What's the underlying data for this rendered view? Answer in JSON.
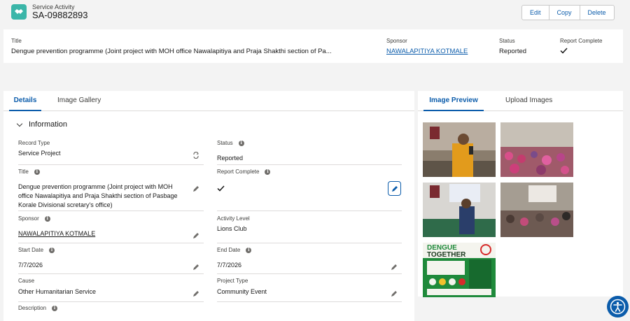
{
  "header": {
    "object_label": "Service Activity",
    "record_name": "SA-09882893",
    "buttons": {
      "edit": "Edit",
      "copy": "Copy",
      "delete": "Delete"
    },
    "icon": "handshake-icon"
  },
  "highlights": {
    "title_label": "Title",
    "title_value": "Dengue prevention programme (Joint project with MOH office Nawalapitiya and Praja Shakthi section of Pa...",
    "sponsor_label": "Sponsor",
    "sponsor_value": "NAWALAPITIYA KOTMALE",
    "status_label": "Status",
    "status_value": "Reported",
    "report_complete_label": "Report Complete"
  },
  "details_tabs": [
    "Details",
    "Image Gallery"
  ],
  "section": {
    "title": "Information"
  },
  "fields": {
    "record_type": {
      "label": "Record Type",
      "value": "Service Project"
    },
    "status": {
      "label": "Status",
      "value": "Reported"
    },
    "title": {
      "label": "Title",
      "value": "Dengue prevention programme (Joint project with MOH office Nawalapitiya and Praja Shakthi section of Pasbage Korale Divisional scretary's office)"
    },
    "report_complete": {
      "label": "Report Complete"
    },
    "sponsor": {
      "label": "Sponsor",
      "value": "NAWALAPITIYA KOTMALE"
    },
    "activity_level": {
      "label": "Activity Level",
      "value": "Lions Club"
    },
    "start_date": {
      "label": "Start Date",
      "value": "7/7/2026"
    },
    "end_date": {
      "label": "End Date",
      "value": "7/7/2026"
    },
    "cause": {
      "label": "Cause",
      "value": "Other Humanitarian Service"
    },
    "project_type": {
      "label": "Project Type",
      "value": "Community Event"
    },
    "description": {
      "label": "Description"
    }
  },
  "preview_tabs": [
    "Image Preview",
    "Upload Images"
  ],
  "poster": {
    "line1": "DENGUE",
    "line2": "TOGETHER"
  },
  "colors": {
    "brand_blue": "#0b5cab",
    "app_icon": "#3bb6a9",
    "poster_green": "#1f8a3b"
  }
}
